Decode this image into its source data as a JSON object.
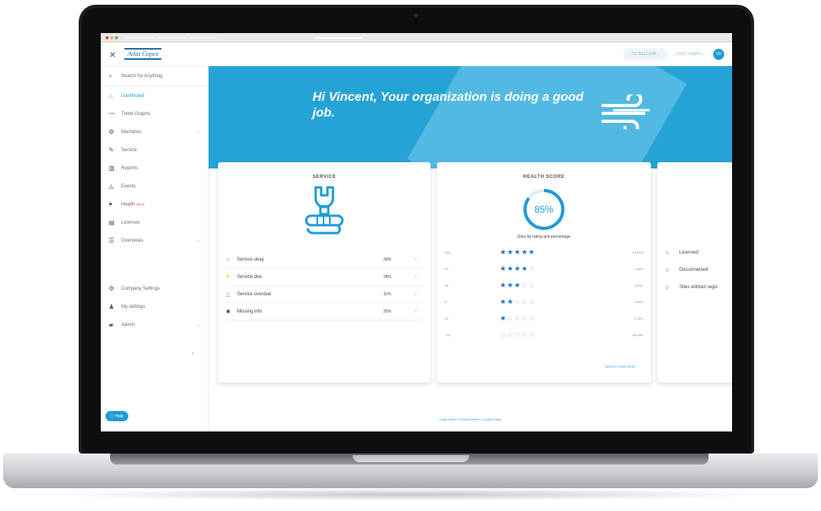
{
  "browser": {
    "tabs": [
      "",
      "",
      ""
    ],
    "url": ""
  },
  "topbar": {
    "close_icon": "close-icon",
    "logo": "Atlas Copco",
    "site_selector": "TIC BELGIUM ⌄",
    "date_selector": "LAST 7 DAYS ⌄",
    "user_initials": "VD"
  },
  "sidebar": {
    "search_label": "Search for Anything",
    "items": [
      {
        "label": "Dashboard",
        "icon": "home-icon",
        "glyph": "⌂",
        "active": true
      },
      {
        "label": "Trend Graphs",
        "icon": "trend-icon",
        "glyph": "〰"
      },
      {
        "label": "Machines",
        "icon": "compressor-icon",
        "glyph": "⚙",
        "chevron": true
      },
      {
        "label": "Service",
        "icon": "wrench-icon",
        "glyph": "✎"
      },
      {
        "label": "Reports",
        "icon": "bar-chart-icon",
        "glyph": "▥"
      },
      {
        "label": "Events",
        "icon": "bell-icon",
        "glyph": "◬"
      },
      {
        "label": "Health",
        "icon": "heart-icon",
        "glyph": "♥",
        "badge": "BETA"
      },
      {
        "label": "Licenses",
        "icon": "license-icon",
        "glyph": "▤"
      },
      {
        "label": "Overviews",
        "icon": "list-icon",
        "glyph": "☰",
        "chevron": true
      }
    ],
    "bottom_items": [
      {
        "label": "Company Settings",
        "icon": "settings-icon",
        "glyph": "⚙"
      },
      {
        "label": "My settings",
        "icon": "user-icon",
        "glyph": "♟"
      },
      {
        "label": "Admin",
        "icon": "briefcase-icon",
        "glyph": "▰",
        "chevron": true
      }
    ],
    "collapse_glyph": "‹",
    "help_label": "Help"
  },
  "hero": {
    "greeting": "Hi Vincent, Your organization is doing a good job.",
    "icon": "wind-icon"
  },
  "service_card": {
    "title": "SERVICE",
    "icon": "wrench-fist-icon",
    "rows": [
      {
        "label": "Service okay",
        "pct": "30%",
        "glyph": "✓",
        "color": "#7fb04a"
      },
      {
        "label": "Service due",
        "pct": "28%",
        "glyph": "●",
        "color": "#f0c419"
      },
      {
        "label": "Service overdue",
        "pct": "11%",
        "glyph": "△",
        "color": "#e03c3c"
      },
      {
        "label": "Missing info",
        "pct": "25%",
        "glyph": "✱",
        "color": "#444444"
      }
    ]
  },
  "health_card": {
    "title": "HEALTH SCORE",
    "score": "85%",
    "score_value": 0.85,
    "sites_label": "Sites by rating and percentage",
    "ratings": [
      {
        "count": "456",
        "stars": 5,
        "pct": "34.61%"
      },
      {
        "count": "30",
        "stars": 4,
        "pct": "2.45%"
      },
      {
        "count": "46",
        "stars": 3,
        "pct": "3.42%"
      },
      {
        "count": "6",
        "stars": 2,
        "pct": "0.50%"
      },
      {
        "count": "32",
        "stars": 1,
        "pct": "3.13%"
      },
      {
        "count": "776",
        "stars": 0,
        "pct": "56.29%"
      }
    ],
    "link": "HEALTH OVERVIEW ›"
  },
  "license_card": {
    "rows": [
      {
        "label": "Licensed",
        "glyph": "⊙"
      },
      {
        "label": "Disconnected",
        "glyph": "⊙"
      },
      {
        "label": "Sites without regis",
        "glyph": "⊙"
      }
    ]
  },
  "footer": {
    "text": "Legal Notice | Privacy Notice | Cookie Policy"
  },
  "colors": {
    "accent": "#1e9bd7",
    "hero": "#26a3d6",
    "star": "#1e73be"
  }
}
